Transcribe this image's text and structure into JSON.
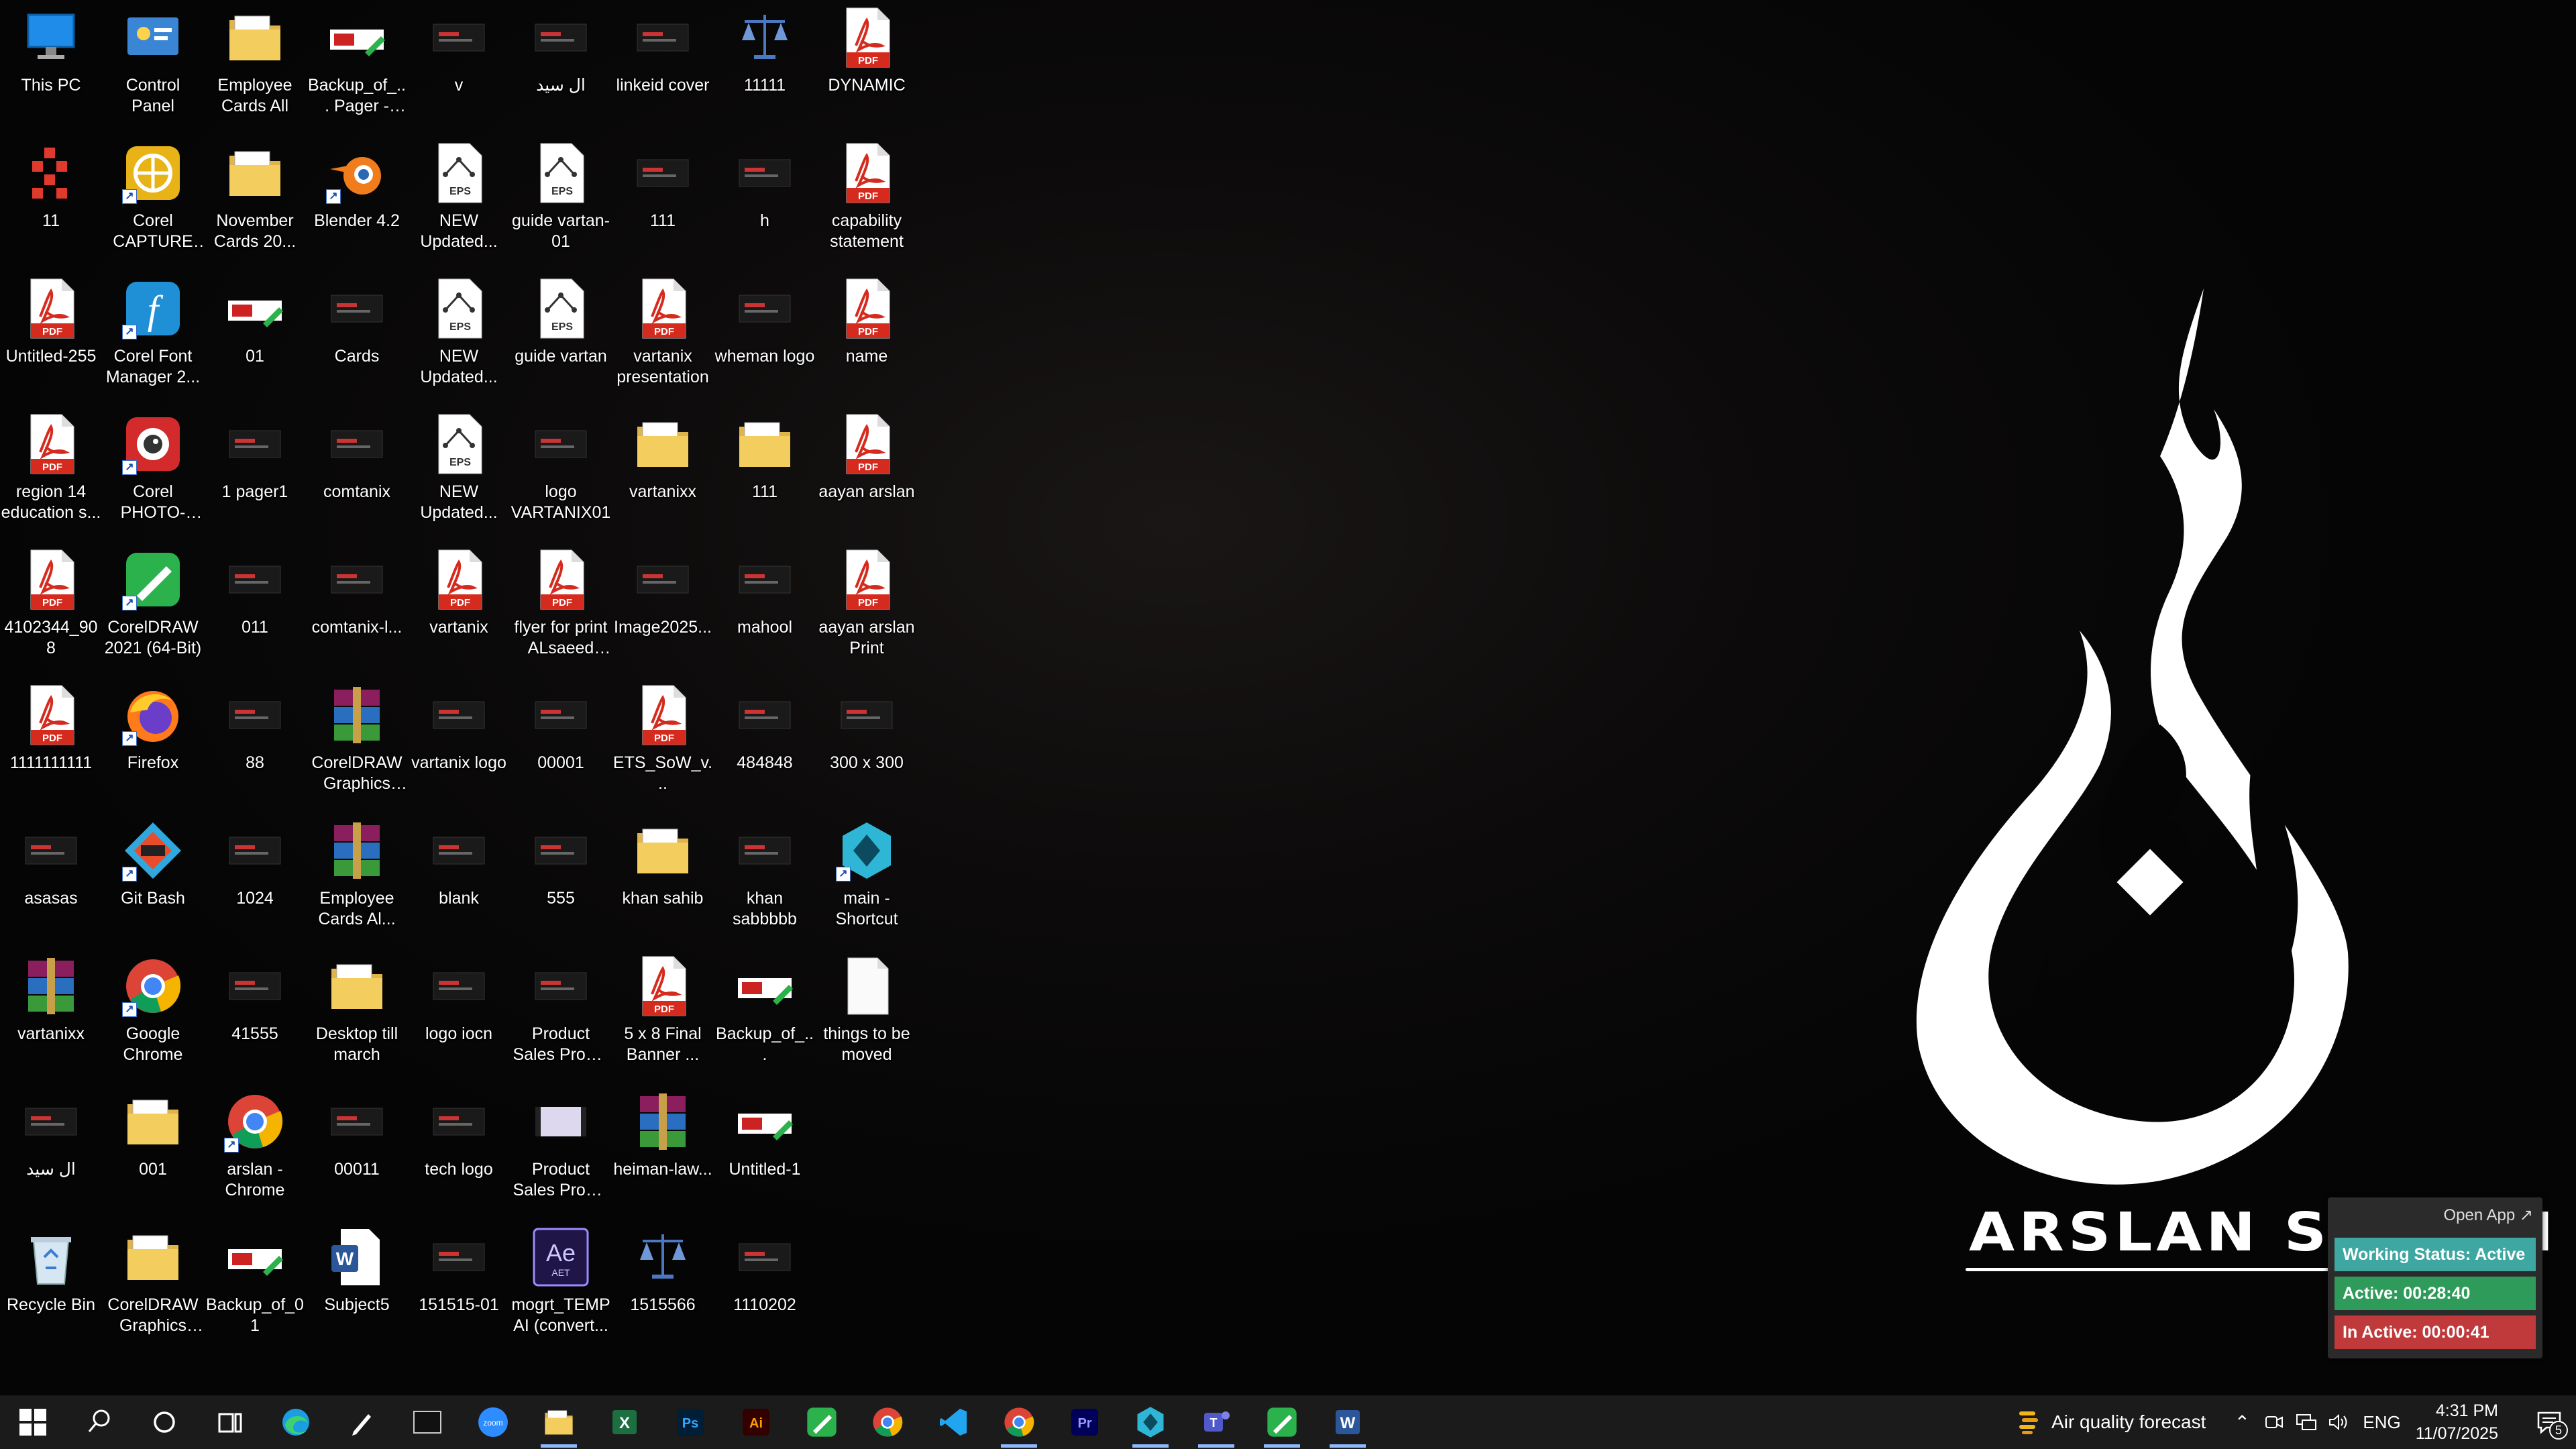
{
  "desktop": {
    "icons": [
      {
        "label": "This PC",
        "icon": "pc-icon",
        "shortcut": false
      },
      {
        "label": "11",
        "icon": "squares-app-icon",
        "shortcut": false
      },
      {
        "label": "Untitled-255",
        "icon": "pdf-icon",
        "shortcut": false
      },
      {
        "label": "region 14 education s...",
        "icon": "pdf-icon",
        "shortcut": false
      },
      {
        "label": "4102344_908",
        "icon": "pdf-icon",
        "shortcut": false
      },
      {
        "label": "1111111111",
        "icon": "pdf-icon",
        "shortcut": false
      },
      {
        "label": "asasas",
        "icon": "image-thumb-icon",
        "shortcut": false
      },
      {
        "label": "vartanixx",
        "icon": "winrar-icon",
        "shortcut": false
      },
      {
        "label": "ال سيد",
        "icon": "image-thumb-icon",
        "shortcut": false
      },
      {
        "label": "Recycle Bin",
        "icon": "recycle-bin-icon",
        "shortcut": false
      },
      {
        "label": "Control Panel",
        "icon": "control-panel-icon",
        "shortcut": false
      },
      {
        "label": "Corel CAPTURE 2...",
        "icon": "corel-capture-icon",
        "shortcut": true
      },
      {
        "label": "Corel Font Manager 2...",
        "icon": "corel-font-icon",
        "shortcut": true
      },
      {
        "label": "Corel PHOTO-PAI...",
        "icon": "corel-photopaint-icon",
        "shortcut": true
      },
      {
        "label": "CorelDRAW 2021 (64-Bit)",
        "icon": "coreldraw-icon",
        "shortcut": true
      },
      {
        "label": "Firefox",
        "icon": "firefox-icon",
        "shortcut": true
      },
      {
        "label": "Git Bash",
        "icon": "git-bash-icon",
        "shortcut": true
      },
      {
        "label": "Google Chrome",
        "icon": "chrome-icon",
        "shortcut": true
      },
      {
        "label": "001",
        "icon": "folder-icon",
        "shortcut": false
      },
      {
        "label": "CorelDRAW Graphics Su...",
        "icon": "folder-icon",
        "shortcut": false
      },
      {
        "label": "Employee Cards All",
        "icon": "folder-icon",
        "shortcut": false
      },
      {
        "label": "November Cards 20...",
        "icon": "folder-icon",
        "shortcut": false
      },
      {
        "label": "01",
        "icon": "cdr-file-icon",
        "shortcut": false
      },
      {
        "label": "1 pager1",
        "icon": "image-thumb-icon",
        "shortcut": false
      },
      {
        "label": "011",
        "icon": "image-thumb-icon",
        "shortcut": false
      },
      {
        "label": "88",
        "icon": "image-thumb-icon",
        "shortcut": false
      },
      {
        "label": "1024",
        "icon": "image-thumb-icon",
        "shortcut": false
      },
      {
        "label": "41555",
        "icon": "image-thumb-icon",
        "shortcut": false
      },
      {
        "label": "arslan - Chrome",
        "icon": "chrome-icon",
        "shortcut": true
      },
      {
        "label": "Backup_of_01",
        "icon": "cdr-file-icon",
        "shortcut": false
      },
      {
        "label": "Backup_of_... Pager - NY...",
        "icon": "cdr-file-icon",
        "shortcut": false
      },
      {
        "label": "Blender 4.2",
        "icon": "blender-icon",
        "shortcut": true
      },
      {
        "label": "Cards",
        "icon": "image-thumb-icon",
        "shortcut": false
      },
      {
        "label": "comtanix",
        "icon": "image-thumb-icon",
        "shortcut": false
      },
      {
        "label": "comtanix-l...",
        "icon": "image-thumb-icon",
        "shortcut": false
      },
      {
        "label": "CorelDRAW Graphics Su...",
        "icon": "winrar-icon",
        "shortcut": false
      },
      {
        "label": "Employee Cards Al...",
        "icon": "winrar-icon",
        "shortcut": false
      },
      {
        "label": "Desktop till march",
        "icon": "folder-icon",
        "shortcut": false
      },
      {
        "label": "00011",
        "icon": "image-thumb-icon",
        "shortcut": false
      },
      {
        "label": "Subject5",
        "icon": "word-doc-icon",
        "shortcut": false
      },
      {
        "label": "v",
        "icon": "image-thumb-icon",
        "shortcut": false
      },
      {
        "label": "NEW Updated...",
        "icon": "eps-icon",
        "shortcut": false
      },
      {
        "label": "NEW Updated...",
        "icon": "eps-icon",
        "shortcut": false
      },
      {
        "label": "NEW Updated...",
        "icon": "eps-icon",
        "shortcut": false
      },
      {
        "label": "vartanix",
        "icon": "pdf-icon",
        "shortcut": false
      },
      {
        "label": "vartanix logo",
        "icon": "image-thumb-icon",
        "shortcut": false
      },
      {
        "label": "blank",
        "icon": "image-thumb-icon",
        "shortcut": false
      },
      {
        "label": "logo iocn",
        "icon": "image-thumb-icon",
        "shortcut": false
      },
      {
        "label": "tech logo",
        "icon": "image-thumb-icon",
        "shortcut": false
      },
      {
        "label": "151515-01",
        "icon": "image-thumb-icon",
        "shortcut": false
      },
      {
        "label": "ال سيد",
        "icon": "image-thumb-icon",
        "shortcut": false
      },
      {
        "label": "guide vartan-01",
        "icon": "eps-icon",
        "shortcut": false
      },
      {
        "label": "guide vartan",
        "icon": "eps-icon",
        "shortcut": false
      },
      {
        "label": "logo VARTANIX01",
        "icon": "image-thumb-icon",
        "shortcut": false
      },
      {
        "label": "flyer for print ALsaeed po...",
        "icon": "pdf-icon",
        "shortcut": false
      },
      {
        "label": "00001",
        "icon": "image-thumb-icon",
        "shortcut": false
      },
      {
        "label": "555",
        "icon": "image-thumb-icon",
        "shortcut": false
      },
      {
        "label": "Product Sales Promo Pack...",
        "icon": "image-thumb-icon",
        "shortcut": false
      },
      {
        "label": "Product Sales Promo Pack...",
        "icon": "video-thumb-icon",
        "shortcut": false
      },
      {
        "label": "mogrt_TEMP AI (convert...",
        "icon": "after-effects-icon",
        "shortcut": false
      },
      {
        "label": "linkeid cover",
        "icon": "image-thumb-icon",
        "shortcut": false
      },
      {
        "label": "111",
        "icon": "image-thumb-icon",
        "shortcut": false
      },
      {
        "label": "vartanix presentation",
        "icon": "pdf-icon",
        "shortcut": false
      },
      {
        "label": "vartanixx",
        "icon": "folder-icon",
        "shortcut": false
      },
      {
        "label": "Image2025...",
        "icon": "image-thumb-icon",
        "shortcut": false
      },
      {
        "label": "ETS_SoW_v...",
        "icon": "pdf-icon",
        "shortcut": false
      },
      {
        "label": "khan sahib",
        "icon": "folder-icon",
        "shortcut": false
      },
      {
        "label": "5 x 8 Final Banner ...",
        "icon": "pdf-icon",
        "shortcut": false
      },
      {
        "label": "heiman-law...",
        "icon": "winrar-icon",
        "shortcut": false
      },
      {
        "label": "1515566",
        "icon": "scales-icon",
        "shortcut": false
      },
      {
        "label": "11111",
        "icon": "scales-icon",
        "shortcut": false
      },
      {
        "label": "h",
        "icon": "image-thumb-icon",
        "shortcut": false
      },
      {
        "label": "wheman logo",
        "icon": "image-thumb-icon",
        "shortcut": false
      },
      {
        "label": "111",
        "icon": "folder-icon",
        "shortcut": false
      },
      {
        "label": "mahool",
        "icon": "image-thumb-icon",
        "shortcut": false
      },
      {
        "label": "484848",
        "icon": "image-thumb-icon",
        "shortcut": false
      },
      {
        "label": "khan sabbbbb",
        "icon": "image-thumb-icon",
        "shortcut": false
      },
      {
        "label": "Backup_of_...",
        "icon": "cdr-file-icon",
        "shortcut": false
      },
      {
        "label": "Untitled-1",
        "icon": "cdr-file-icon",
        "shortcut": false
      },
      {
        "label": "1110202",
        "icon": "image-thumb-icon",
        "shortcut": false
      },
      {
        "label": "DYNAMIC",
        "icon": "pdf-icon",
        "shortcut": false
      },
      {
        "label": "capability statement",
        "icon": "pdf-icon",
        "shortcut": false
      },
      {
        "label": "name",
        "icon": "pdf-icon",
        "shortcut": false
      },
      {
        "label": "aayan arslan",
        "icon": "pdf-icon",
        "shortcut": false
      },
      {
        "label": "aayan arslan Print",
        "icon": "pdf-icon",
        "shortcut": false
      },
      {
        "label": "300 x 300",
        "icon": "image-thumb-icon",
        "shortcut": false
      },
      {
        "label": "main - Shortcut",
        "icon": "app-shortcut-icon",
        "shortcut": true
      },
      {
        "label": "things to be moved",
        "icon": "text-file-icon",
        "shortcut": false
      }
    ]
  },
  "wallpaper": {
    "name_text": "ARSLAN SHEIKH"
  },
  "timer_widget": {
    "open_app": "Open App ↗",
    "working_status": "Working Status: Active",
    "active": "Active: 00:28:40",
    "inactive": "In Active: 00:00:41"
  },
  "taskbar": {
    "apps": [
      {
        "name": "start-button",
        "icon": "windows-logo-icon",
        "running": false
      },
      {
        "name": "search-button",
        "icon": "search-icon",
        "running": false
      },
      {
        "name": "cortana-button",
        "icon": "cortana-ring-icon",
        "running": false
      },
      {
        "name": "task-view-button",
        "icon": "task-view-icon",
        "running": false
      },
      {
        "name": "edge-button",
        "icon": "edge-icon",
        "running": false
      },
      {
        "name": "pen-tool-button",
        "icon": "pen-icon",
        "running": false
      },
      {
        "name": "terminal-button",
        "icon": "terminal-icon",
        "running": false
      },
      {
        "name": "zoom-button",
        "icon": "zoom-icon",
        "running": false
      },
      {
        "name": "file-explorer-button",
        "icon": "folder-icon",
        "running": true
      },
      {
        "name": "excel-button",
        "icon": "excel-icon",
        "running": false
      },
      {
        "name": "photoshop-button",
        "icon": "photoshop-icon",
        "running": false
      },
      {
        "name": "illustrator-button",
        "icon": "illustrator-icon",
        "running": false
      },
      {
        "name": "coreldraw-button",
        "icon": "coreldraw-icon",
        "running": false
      },
      {
        "name": "chrome-button",
        "icon": "chrome-icon",
        "running": false
      },
      {
        "name": "vscode-button",
        "icon": "vscode-icon",
        "running": false
      },
      {
        "name": "chrome-profile-button",
        "icon": "chrome-icon",
        "running": true
      },
      {
        "name": "premiere-button",
        "icon": "premiere-icon",
        "running": false
      },
      {
        "name": "tracker-app-button",
        "icon": "app-shortcut-icon",
        "running": true
      },
      {
        "name": "teams-button",
        "icon": "teams-icon",
        "running": true
      },
      {
        "name": "coreldraw-running-button",
        "icon": "coreldraw-icon",
        "running": true
      },
      {
        "name": "word-button",
        "icon": "word-icon",
        "running": true
      }
    ],
    "weather_text": "Air quality forecast",
    "language": "ENG",
    "time": "4:31 PM",
    "date": "11/07/2025",
    "notification_count": "5"
  },
  "colors": {
    "working": "#3ea7a1",
    "active": "#2f9b5a",
    "inactive": "#c0393b",
    "taskbar": "#1b1b1b"
  }
}
